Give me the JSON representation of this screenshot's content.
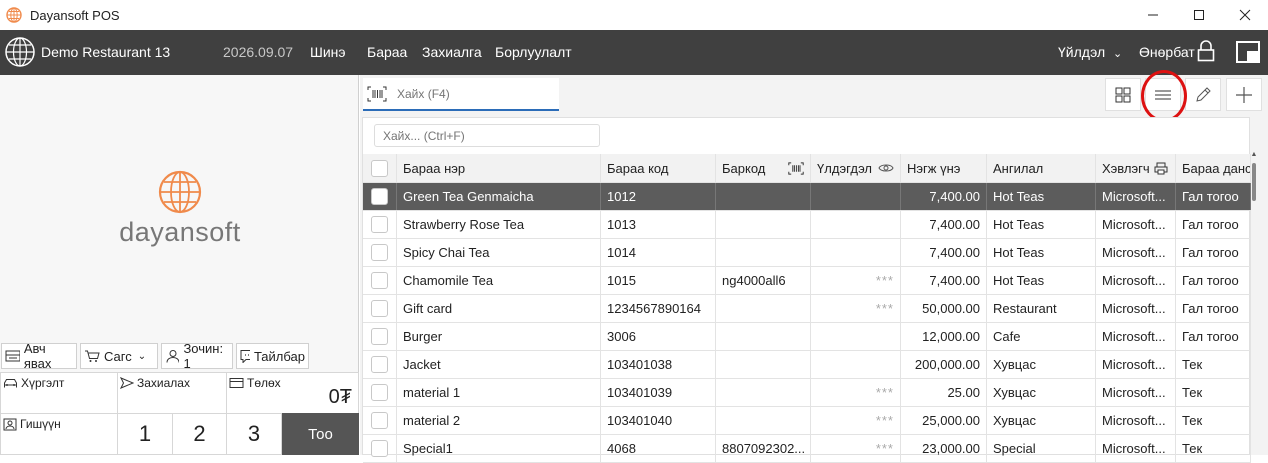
{
  "window": {
    "title": "Dayansoft POS",
    "controls": [
      "minimize",
      "maximize",
      "close"
    ]
  },
  "topbar": {
    "restaurant": "Demo Restaurant 13",
    "date": "2026.09.07",
    "nav": [
      "Шинэ",
      "Бараа",
      "Захиалга",
      "Борлуулалт"
    ],
    "shift_label": "Үйлдэл",
    "user_label": "Өнөрбат"
  },
  "brand": {
    "name": "dayansoft"
  },
  "actions": {
    "takeaway": "Авч явах",
    "cart": "Сагс",
    "guest": "Зочин: 1",
    "note": "Тайлбар"
  },
  "order_grid": {
    "delivery": "Хүргэлт",
    "order": "Захиалах",
    "payment": "Төлөх",
    "total": "0₮",
    "member": "Гишүүн",
    "numbers": [
      "1",
      "2",
      "3"
    ],
    "qty_button": "Тоо"
  },
  "search": {
    "main_placeholder": "Хайх (F4)",
    "filter_placeholder": "Хайх... (Ctrl+F)"
  },
  "table": {
    "columns": [
      "Бараа нэр",
      "Бараа код",
      "Баркод",
      "Үлдэгдэл",
      "Нэгж үнэ",
      "Ангилал",
      "Хэвлэгч",
      "Бараа данс"
    ],
    "rows": [
      {
        "name": "Green Tea Genmaicha",
        "code": "1012",
        "barcode": "",
        "stock": "",
        "price": "7,400.00",
        "category": "Hot Teas",
        "printer": "Microsoft...",
        "account": "Гал тогоо",
        "selected": true
      },
      {
        "name": "Strawberry Rose Tea",
        "code": "1013",
        "barcode": "",
        "stock": "",
        "price": "7,400.00",
        "category": "Hot Teas",
        "printer": "Microsoft...",
        "account": "Гал тогоо"
      },
      {
        "name": "Spicy Chai Tea",
        "code": "1014",
        "barcode": "",
        "stock": "",
        "price": "7,400.00",
        "category": "Hot Teas",
        "printer": "Microsoft...",
        "account": "Гал тогоо"
      },
      {
        "name": "Chamomile Tea",
        "code": "1015",
        "barcode": "ng4000all6",
        "stock": "***",
        "price": "7,400.00",
        "category": "Hot Teas",
        "printer": "Microsoft...",
        "account": "Гал тогоо"
      },
      {
        "name": "Gift card",
        "code": "1234567890164",
        "barcode": "",
        "stock": "***",
        "price": "50,000.00",
        "category": "Restaurant",
        "printer": "Microsoft...",
        "account": "Гал тогоо"
      },
      {
        "name": "Burger",
        "code": "3006",
        "barcode": "",
        "stock": "",
        "price": "12,000.00",
        "category": "Cafe",
        "printer": "Microsoft...",
        "account": "Гал тогоо"
      },
      {
        "name": "Jacket",
        "code": "103401038",
        "barcode": "",
        "stock": "",
        "price": "200,000.00",
        "category": "Хувцас",
        "printer": "Microsoft...",
        "account": "Тек"
      },
      {
        "name": "material 1",
        "code": "103401039",
        "barcode": "",
        "stock": "***",
        "price": "25.00",
        "category": "Хувцас",
        "printer": "Microsoft...",
        "account": "Тек"
      },
      {
        "name": "material 2",
        "code": "103401040",
        "barcode": "",
        "stock": "***",
        "price": "25,000.00",
        "category": "Хувцас",
        "printer": "Microsoft...",
        "account": "Тек"
      },
      {
        "name": "Special1",
        "code": "4068",
        "barcode": "8807092302...",
        "stock": "***",
        "price": "23,000.00",
        "category": "Special",
        "printer": "Microsoft...",
        "account": "Тек"
      }
    ]
  },
  "colors": {
    "topbar": "#404040",
    "selected_row": "#5c5c5c",
    "accent": "#2b6cb8",
    "brand_orange": "#f08a4b",
    "highlight": "#dd1111"
  }
}
